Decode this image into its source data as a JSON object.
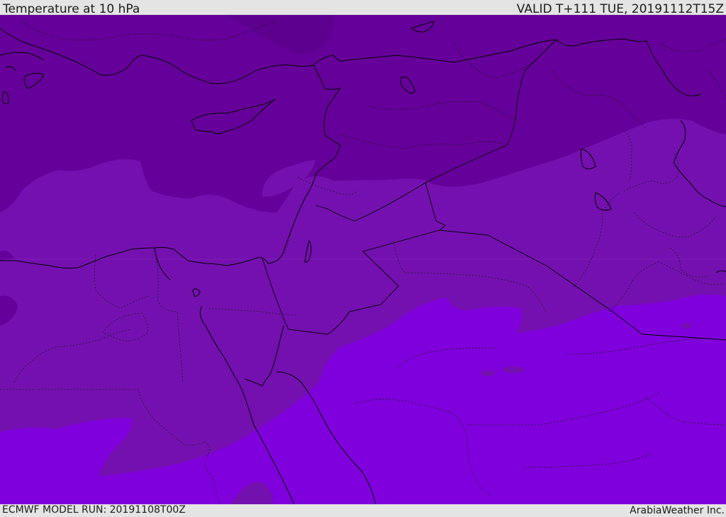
{
  "header": {
    "title": "Temperature at 10 hPa",
    "valid_time": "VALID T+111 TUE, 20191112T15Z"
  },
  "footer": {
    "model_run": "ECMWF MODEL RUN: 20191108T00Z",
    "provider": "ArabiaWeather Inc."
  },
  "colors": {
    "band_coldest": "#66009a",
    "band_mid": "#7410b0",
    "band_warm": "#7f00dc",
    "coastline": "#000000",
    "border": "#000000",
    "admin_border": "#222222"
  }
}
